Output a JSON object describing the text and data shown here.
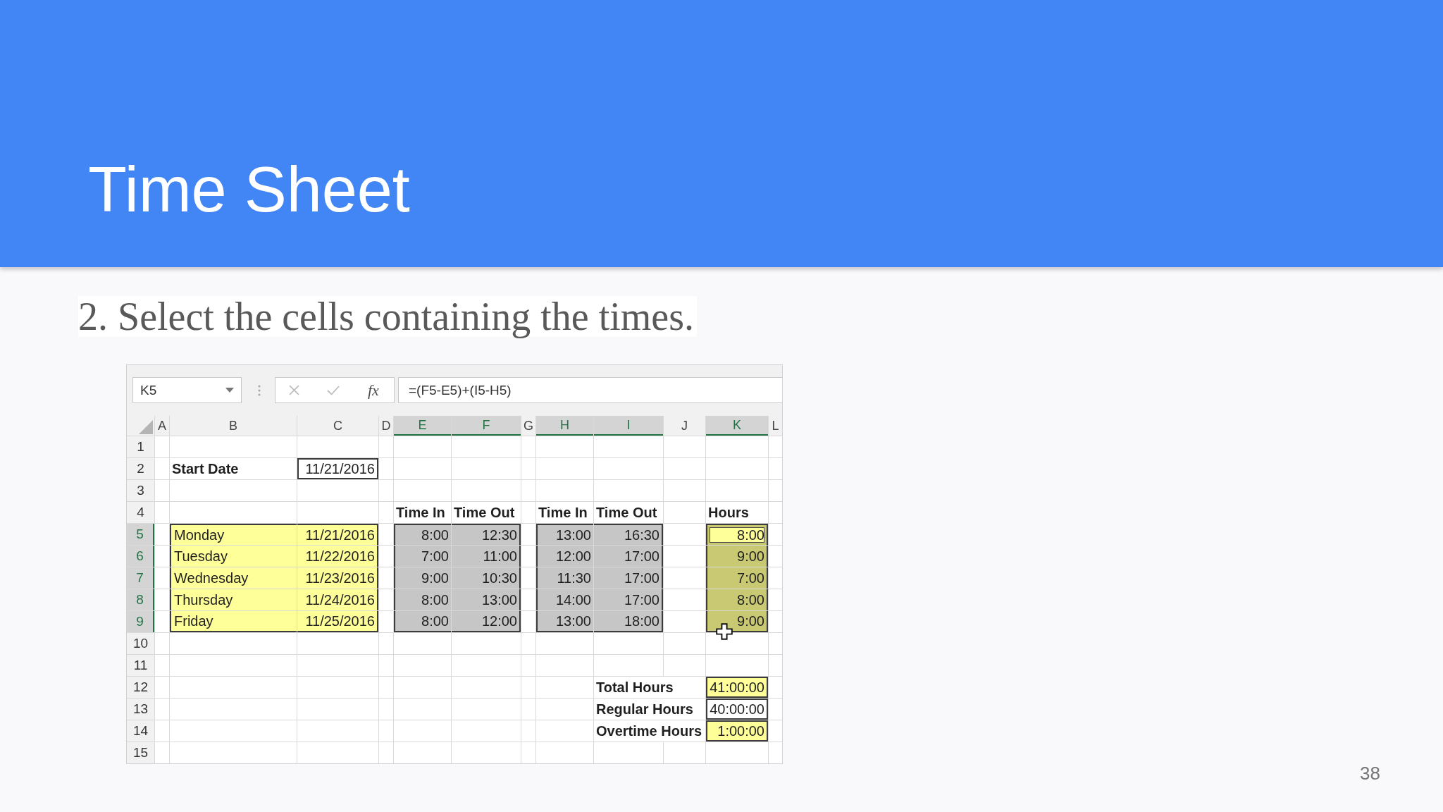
{
  "slide": {
    "title": "Time Sheet",
    "instruction": "2. Select the cells containing the times.",
    "page_number": "38"
  },
  "spreadsheet": {
    "name_box": "K5",
    "formula_buttons": [
      {
        "kind": "cancel",
        "disabled": true
      },
      {
        "kind": "enter",
        "disabled": true
      },
      {
        "kind": "function",
        "text": "fx",
        "disabled": false
      }
    ],
    "formula": "=(F5-E5)+(I5-H5)",
    "columns": [
      {
        "label": "A",
        "selected": false
      },
      {
        "label": "B",
        "selected": false
      },
      {
        "label": "C",
        "selected": false
      },
      {
        "label": "D",
        "selected": false
      },
      {
        "label": "E",
        "selected": true
      },
      {
        "label": "F",
        "selected": true
      },
      {
        "label": "G",
        "selected": false
      },
      {
        "label": "H",
        "selected": true
      },
      {
        "label": "I",
        "selected": true
      },
      {
        "label": "J",
        "selected": false
      },
      {
        "label": "K",
        "selected": true
      },
      {
        "label": "L",
        "selected": false
      }
    ],
    "rows": [
      {
        "label": "1",
        "selected": false,
        "cells": [
          {
            "kind": "blank",
            "selected": false,
            "highlighted": false,
            "active": false
          },
          {
            "kind": "blank",
            "selected": false,
            "highlighted": false,
            "active": false
          },
          {
            "kind": "blank",
            "selected": false,
            "highlighted": false,
            "active": false
          },
          {
            "kind": "blank",
            "selected": false,
            "highlighted": false,
            "active": false
          },
          {
            "kind": "blank",
            "selected": false,
            "highlighted": false,
            "active": false
          },
          {
            "kind": "blank",
            "selected": false,
            "highlighted": false,
            "active": false
          },
          {
            "kind": "blank",
            "selected": false,
            "highlighted": false,
            "active": false
          },
          {
            "kind": "blank",
            "selected": false,
            "highlighted": false,
            "active": false
          },
          {
            "kind": "blank",
            "selected": false,
            "highlighted": false,
            "active": false
          },
          {
            "kind": "blank",
            "selected": false,
            "highlighted": false,
            "active": false
          },
          {
            "kind": "blank",
            "selected": false,
            "highlighted": false,
            "active": false
          },
          {
            "kind": "blank",
            "selected": false,
            "highlighted": false,
            "active": false
          }
        ]
      },
      {
        "label": "2",
        "selected": false,
        "cells": [
          {
            "kind": "blank",
            "selected": false,
            "highlighted": false,
            "active": false
          },
          {
            "kind": "label",
            "text": "Start Date",
            "selected": false,
            "highlighted": false,
            "active": false
          },
          {
            "kind": "number",
            "text": "11/21/2016",
            "selected": false,
            "highlighted": false,
            "active": false,
            "boxed": true
          },
          {
            "kind": "blank",
            "selected": false,
            "highlighted": false,
            "active": false
          },
          {
            "kind": "blank",
            "selected": false,
            "highlighted": false,
            "active": false
          },
          {
            "kind": "blank",
            "selected": false,
            "highlighted": false,
            "active": false
          },
          {
            "kind": "blank",
            "selected": false,
            "highlighted": false,
            "active": false
          },
          {
            "kind": "blank",
            "selected": false,
            "highlighted": false,
            "active": false
          },
          {
            "kind": "blank",
            "selected": false,
            "highlighted": false,
            "active": false
          },
          {
            "kind": "blank",
            "selected": false,
            "highlighted": false,
            "active": false
          },
          {
            "kind": "blank",
            "selected": false,
            "highlighted": false,
            "active": false
          },
          {
            "kind": "blank",
            "selected": false,
            "highlighted": false,
            "active": false
          }
        ]
      },
      {
        "label": "3",
        "selected": false,
        "cells": [
          {
            "kind": "blank",
            "selected": false,
            "highlighted": false,
            "active": false
          },
          {
            "kind": "blank",
            "selected": false,
            "highlighted": false,
            "active": false
          },
          {
            "kind": "blank",
            "selected": false,
            "highlighted": false,
            "active": false
          },
          {
            "kind": "blank",
            "selected": false,
            "highlighted": false,
            "active": false
          },
          {
            "kind": "blank",
            "selected": false,
            "highlighted": false,
            "active": false
          },
          {
            "kind": "blank",
            "selected": false,
            "highlighted": false,
            "active": false
          },
          {
            "kind": "blank",
            "selected": false,
            "highlighted": false,
            "active": false
          },
          {
            "kind": "blank",
            "selected": false,
            "highlighted": false,
            "active": false
          },
          {
            "kind": "blank",
            "selected": false,
            "highlighted": false,
            "active": false
          },
          {
            "kind": "blank",
            "selected": false,
            "highlighted": false,
            "active": false
          },
          {
            "kind": "blank",
            "selected": false,
            "highlighted": false,
            "active": false
          },
          {
            "kind": "blank",
            "selected": false,
            "highlighted": false,
            "active": false
          }
        ]
      },
      {
        "label": "4",
        "selected": false,
        "cells": [
          {
            "kind": "blank",
            "selected": false,
            "highlighted": false,
            "active": false
          },
          {
            "kind": "blank",
            "selected": false,
            "highlighted": false,
            "active": false
          },
          {
            "kind": "blank",
            "selected": false,
            "highlighted": false,
            "active": false
          },
          {
            "kind": "blank",
            "selected": false,
            "highlighted": false,
            "active": false
          },
          {
            "kind": "label",
            "text": "Time In",
            "selected": false,
            "highlighted": false,
            "active": false
          },
          {
            "kind": "label",
            "text": "Time Out",
            "selected": false,
            "highlighted": false,
            "active": false
          },
          {
            "kind": "blank",
            "selected": false,
            "highlighted": false,
            "active": false
          },
          {
            "kind": "label",
            "text": "Time In",
            "selected": false,
            "highlighted": false,
            "active": false
          },
          {
            "kind": "label",
            "text": "Time Out",
            "selected": false,
            "highlighted": false,
            "active": false
          },
          {
            "kind": "blank",
            "selected": false,
            "highlighted": false,
            "active": false
          },
          {
            "kind": "label",
            "text": "Hours",
            "selected": false,
            "highlighted": false,
            "active": false
          },
          {
            "kind": "blank",
            "selected": false,
            "highlighted": false,
            "active": false
          }
        ]
      },
      {
        "label": "5",
        "selected": true,
        "cells": [
          {
            "kind": "blank",
            "selected": false,
            "highlighted": false,
            "active": false
          },
          {
            "kind": "text",
            "text": "Monday",
            "selected": false,
            "highlighted": true,
            "active": false,
            "border_top": true,
            "border_left": true
          },
          {
            "kind": "number",
            "text": "11/21/2016",
            "selected": false,
            "highlighted": true,
            "active": false,
            "border_top": true,
            "border_right": true
          },
          {
            "kind": "blank",
            "selected": false,
            "highlighted": false,
            "active": false
          },
          {
            "kind": "number",
            "text": "8:00",
            "selected": true,
            "highlighted": false,
            "active": false,
            "border_top": true,
            "border_left": true
          },
          {
            "kind": "number",
            "text": "12:30",
            "selected": true,
            "highlighted": false,
            "active": false,
            "border_top": true,
            "border_right": true
          },
          {
            "kind": "blank",
            "selected": false,
            "highlighted": false,
            "active": false
          },
          {
            "kind": "number",
            "text": "13:00",
            "selected": true,
            "highlighted": false,
            "active": false,
            "border_top": true,
            "border_left": true
          },
          {
            "kind": "number",
            "text": "16:30",
            "selected": true,
            "highlighted": false,
            "active": false,
            "border_top": true,
            "border_right": true
          },
          {
            "kind": "blank",
            "selected": false,
            "highlighted": false,
            "active": false
          },
          {
            "kind": "number",
            "text": "8:00",
            "selected": true,
            "highlighted": true,
            "active": true,
            "border_top": true,
            "border_right": true,
            "border_left": true
          },
          {
            "kind": "blank",
            "selected": false,
            "highlighted": false,
            "active": false
          }
        ]
      },
      {
        "label": "6",
        "selected": true,
        "cells": [
          {
            "kind": "blank",
            "selected": false,
            "highlighted": false,
            "active": false
          },
          {
            "kind": "text",
            "text": "Tuesday",
            "selected": false,
            "highlighted": true,
            "active": false,
            "border_left": true
          },
          {
            "kind": "number",
            "text": "11/22/2016",
            "selected": false,
            "highlighted": true,
            "active": false,
            "border_right": true
          },
          {
            "kind": "blank",
            "selected": false,
            "highlighted": false,
            "active": false
          },
          {
            "kind": "number",
            "text": "7:00",
            "selected": true,
            "highlighted": false,
            "active": false,
            "border_left": true
          },
          {
            "kind": "number",
            "text": "11:00",
            "selected": true,
            "highlighted": false,
            "active": false,
            "border_right": true
          },
          {
            "kind": "blank",
            "selected": false,
            "highlighted": false,
            "active": false
          },
          {
            "kind": "number",
            "text": "12:00",
            "selected": true,
            "highlighted": false,
            "active": false,
            "border_left": true
          },
          {
            "kind": "number",
            "text": "17:00",
            "selected": true,
            "highlighted": false,
            "active": false,
            "border_right": true
          },
          {
            "kind": "blank",
            "selected": false,
            "highlighted": false,
            "active": false
          },
          {
            "kind": "number",
            "text": "9:00",
            "selected": true,
            "highlighted": true,
            "active": false,
            "border_right": true,
            "border_left": true
          },
          {
            "kind": "blank",
            "selected": false,
            "highlighted": false,
            "active": false
          }
        ]
      },
      {
        "label": "7",
        "selected": true,
        "cells": [
          {
            "kind": "blank",
            "selected": false,
            "highlighted": false,
            "active": false
          },
          {
            "kind": "text",
            "text": "Wednesday",
            "selected": false,
            "highlighted": true,
            "active": false,
            "border_left": true
          },
          {
            "kind": "number",
            "text": "11/23/2016",
            "selected": false,
            "highlighted": true,
            "active": false,
            "border_right": true
          },
          {
            "kind": "blank",
            "selected": false,
            "highlighted": false,
            "active": false
          },
          {
            "kind": "number",
            "text": "9:00",
            "selected": true,
            "highlighted": false,
            "active": false,
            "border_left": true
          },
          {
            "kind": "number",
            "text": "10:30",
            "selected": true,
            "highlighted": false,
            "active": false,
            "border_right": true
          },
          {
            "kind": "blank",
            "selected": false,
            "highlighted": false,
            "active": false
          },
          {
            "kind": "number",
            "text": "11:30",
            "selected": true,
            "highlighted": false,
            "active": false,
            "border_left": true
          },
          {
            "kind": "number",
            "text": "17:00",
            "selected": true,
            "highlighted": false,
            "active": false,
            "border_right": true
          },
          {
            "kind": "blank",
            "selected": false,
            "highlighted": false,
            "active": false
          },
          {
            "kind": "number",
            "text": "7:00",
            "selected": true,
            "highlighted": true,
            "active": false,
            "border_right": true,
            "border_left": true
          },
          {
            "kind": "blank",
            "selected": false,
            "highlighted": false,
            "active": false
          }
        ]
      },
      {
        "label": "8",
        "selected": true,
        "cells": [
          {
            "kind": "blank",
            "selected": false,
            "highlighted": false,
            "active": false
          },
          {
            "kind": "text",
            "text": "Thursday",
            "selected": false,
            "highlighted": true,
            "active": false,
            "border_left": true
          },
          {
            "kind": "number",
            "text": "11/24/2016",
            "selected": false,
            "highlighted": true,
            "active": false,
            "border_right": true
          },
          {
            "kind": "blank",
            "selected": false,
            "highlighted": false,
            "active": false
          },
          {
            "kind": "number",
            "text": "8:00",
            "selected": true,
            "highlighted": false,
            "active": false,
            "border_left": true
          },
          {
            "kind": "number",
            "text": "13:00",
            "selected": true,
            "highlighted": false,
            "active": false,
            "border_right": true
          },
          {
            "kind": "blank",
            "selected": false,
            "highlighted": false,
            "active": false
          },
          {
            "kind": "number",
            "text": "14:00",
            "selected": true,
            "highlighted": false,
            "active": false,
            "border_left": true
          },
          {
            "kind": "number",
            "text": "17:00",
            "selected": true,
            "highlighted": false,
            "active": false,
            "border_right": true
          },
          {
            "kind": "blank",
            "selected": false,
            "highlighted": false,
            "active": false
          },
          {
            "kind": "number",
            "text": "8:00",
            "selected": true,
            "highlighted": true,
            "active": false,
            "border_right": true,
            "border_left": true
          },
          {
            "kind": "blank",
            "selected": false,
            "highlighted": false,
            "active": false
          }
        ]
      },
      {
        "label": "9",
        "selected": true,
        "cells": [
          {
            "kind": "blank",
            "selected": false,
            "highlighted": false,
            "active": false
          },
          {
            "kind": "text",
            "text": "Friday",
            "selected": false,
            "highlighted": true,
            "active": false,
            "border_bottom": true,
            "border_left": true
          },
          {
            "kind": "number",
            "text": "11/25/2016",
            "selected": false,
            "highlighted": true,
            "active": false,
            "border_right": true,
            "border_bottom": true
          },
          {
            "kind": "blank",
            "selected": false,
            "highlighted": false,
            "active": false
          },
          {
            "kind": "number",
            "text": "8:00",
            "selected": true,
            "highlighted": false,
            "active": false,
            "border_bottom": true,
            "border_left": true
          },
          {
            "kind": "number",
            "text": "12:00",
            "selected": true,
            "highlighted": false,
            "active": false,
            "border_right": true,
            "border_bottom": true
          },
          {
            "kind": "blank",
            "selected": false,
            "highlighted": false,
            "active": false
          },
          {
            "kind": "number",
            "text": "13:00",
            "selected": true,
            "highlighted": false,
            "active": false,
            "border_bottom": true,
            "border_left": true
          },
          {
            "kind": "number",
            "text": "18:00",
            "selected": true,
            "highlighted": false,
            "active": false,
            "border_right": true,
            "border_bottom": true
          },
          {
            "kind": "blank",
            "selected": false,
            "highlighted": false,
            "active": false
          },
          {
            "kind": "number",
            "text": "9:00",
            "selected": true,
            "highlighted": true,
            "active": false,
            "border_right": true,
            "border_bottom": true,
            "border_left": true
          },
          {
            "kind": "blank",
            "selected": false,
            "highlighted": false,
            "active": false
          }
        ]
      },
      {
        "label": "10",
        "selected": false,
        "cells": [
          {
            "kind": "blank",
            "selected": false,
            "highlighted": false,
            "active": false
          },
          {
            "kind": "blank",
            "selected": false,
            "highlighted": false,
            "active": false
          },
          {
            "kind": "blank",
            "selected": false,
            "highlighted": false,
            "active": false
          },
          {
            "kind": "blank",
            "selected": false,
            "highlighted": false,
            "active": false
          },
          {
            "kind": "blank",
            "selected": false,
            "highlighted": false,
            "active": false
          },
          {
            "kind": "blank",
            "selected": false,
            "highlighted": false,
            "active": false
          },
          {
            "kind": "blank",
            "selected": false,
            "highlighted": false,
            "active": false
          },
          {
            "kind": "blank",
            "selected": false,
            "highlighted": false,
            "active": false
          },
          {
            "kind": "blank",
            "selected": false,
            "highlighted": false,
            "active": false
          },
          {
            "kind": "blank",
            "selected": false,
            "highlighted": false,
            "active": false
          },
          {
            "kind": "blank",
            "selected": false,
            "highlighted": false,
            "active": false
          },
          {
            "kind": "blank",
            "selected": false,
            "highlighted": false,
            "active": false
          }
        ]
      },
      {
        "label": "11",
        "selected": false,
        "cells": [
          {
            "kind": "blank",
            "selected": false,
            "highlighted": false,
            "active": false
          },
          {
            "kind": "blank",
            "selected": false,
            "highlighted": false,
            "active": false
          },
          {
            "kind": "blank",
            "selected": false,
            "highlighted": false,
            "active": false
          },
          {
            "kind": "blank",
            "selected": false,
            "highlighted": false,
            "active": false
          },
          {
            "kind": "blank",
            "selected": false,
            "highlighted": false,
            "active": false
          },
          {
            "kind": "blank",
            "selected": false,
            "highlighted": false,
            "active": false
          },
          {
            "kind": "blank",
            "selected": false,
            "highlighted": false,
            "active": false
          },
          {
            "kind": "blank",
            "selected": false,
            "highlighted": false,
            "active": false
          },
          {
            "kind": "blank",
            "selected": false,
            "highlighted": false,
            "active": false
          },
          {
            "kind": "blank",
            "selected": false,
            "highlighted": false,
            "active": false
          },
          {
            "kind": "blank",
            "selected": false,
            "highlighted": false,
            "active": false
          },
          {
            "kind": "blank",
            "selected": false,
            "highlighted": false,
            "active": false
          }
        ]
      },
      {
        "label": "12",
        "selected": false,
        "cells": [
          {
            "kind": "blank",
            "selected": false,
            "highlighted": false,
            "active": false
          },
          {
            "kind": "blank",
            "selected": false,
            "highlighted": false,
            "active": false
          },
          {
            "kind": "blank",
            "selected": false,
            "highlighted": false,
            "active": false
          },
          {
            "kind": "blank",
            "selected": false,
            "highlighted": false,
            "active": false
          },
          {
            "kind": "blank",
            "selected": false,
            "highlighted": false,
            "active": false
          },
          {
            "kind": "blank",
            "selected": false,
            "highlighted": false,
            "active": false
          },
          {
            "kind": "blank",
            "selected": false,
            "highlighted": false,
            "active": false
          },
          {
            "kind": "blank",
            "selected": false,
            "highlighted": false,
            "active": false
          },
          {
            "kind": "spill-label",
            "text": "Total Hours",
            "selected": false,
            "highlighted": false,
            "active": false
          },
          {
            "kind": "number",
            "text": "41:00:00",
            "selected": false,
            "highlighted": true,
            "active": false,
            "boxed": true
          },
          {
            "kind": "blank",
            "selected": false,
            "highlighted": false,
            "active": false
          }
        ]
      },
      {
        "label": "13",
        "selected": false,
        "cells": [
          {
            "kind": "blank",
            "selected": false,
            "highlighted": false,
            "active": false
          },
          {
            "kind": "blank",
            "selected": false,
            "highlighted": false,
            "active": false
          },
          {
            "kind": "blank",
            "selected": false,
            "highlighted": false,
            "active": false
          },
          {
            "kind": "blank",
            "selected": false,
            "highlighted": false,
            "active": false
          },
          {
            "kind": "blank",
            "selected": false,
            "highlighted": false,
            "active": false
          },
          {
            "kind": "blank",
            "selected": false,
            "highlighted": false,
            "active": false
          },
          {
            "kind": "blank",
            "selected": false,
            "highlighted": false,
            "active": false
          },
          {
            "kind": "blank",
            "selected": false,
            "highlighted": false,
            "active": false
          },
          {
            "kind": "spill-label",
            "text": "Regular Hours",
            "selected": false,
            "highlighted": false,
            "active": false
          },
          {
            "kind": "number",
            "text": "40:00:00",
            "selected": false,
            "highlighted": false,
            "active": false,
            "boxed": true
          },
          {
            "kind": "blank",
            "selected": false,
            "highlighted": false,
            "active": false
          }
        ]
      },
      {
        "label": "14",
        "selected": false,
        "cells": [
          {
            "kind": "blank",
            "selected": false,
            "highlighted": false,
            "active": false
          },
          {
            "kind": "blank",
            "selected": false,
            "highlighted": false,
            "active": false
          },
          {
            "kind": "blank",
            "selected": false,
            "highlighted": false,
            "active": false
          },
          {
            "kind": "blank",
            "selected": false,
            "highlighted": false,
            "active": false
          },
          {
            "kind": "blank",
            "selected": false,
            "highlighted": false,
            "active": false
          },
          {
            "kind": "blank",
            "selected": false,
            "highlighted": false,
            "active": false
          },
          {
            "kind": "blank",
            "selected": false,
            "highlighted": false,
            "active": false
          },
          {
            "kind": "blank",
            "selected": false,
            "highlighted": false,
            "active": false
          },
          {
            "kind": "spill-label",
            "text": "Overtime Hours",
            "selected": false,
            "highlighted": false,
            "active": false
          },
          {
            "kind": "number",
            "text": "1:00:00",
            "selected": false,
            "highlighted": true,
            "active": false,
            "boxed": true
          },
          {
            "kind": "blank",
            "selected": false,
            "highlighted": false,
            "active": false
          }
        ]
      },
      {
        "label": "15",
        "selected": false,
        "cells": [
          {
            "kind": "blank",
            "selected": false,
            "highlighted": false,
            "active": false
          },
          {
            "kind": "blank",
            "selected": false,
            "highlighted": false,
            "active": false
          },
          {
            "kind": "blank",
            "selected": false,
            "highlighted": false,
            "active": false
          },
          {
            "kind": "blank",
            "selected": false,
            "highlighted": false,
            "active": false
          },
          {
            "kind": "blank",
            "selected": false,
            "highlighted": false,
            "active": false
          },
          {
            "kind": "blank",
            "selected": false,
            "highlighted": false,
            "active": false
          },
          {
            "kind": "blank",
            "selected": false,
            "highlighted": false,
            "active": false
          },
          {
            "kind": "blank",
            "selected": false,
            "highlighted": false,
            "active": false
          },
          {
            "kind": "blank",
            "selected": false,
            "highlighted": false,
            "active": false
          },
          {
            "kind": "blank",
            "selected": false,
            "highlighted": false,
            "active": false
          },
          {
            "kind": "blank",
            "selected": false,
            "highlighted": false,
            "active": false
          },
          {
            "kind": "blank",
            "selected": false,
            "highlighted": false,
            "active": false
          }
        ]
      }
    ]
  }
}
